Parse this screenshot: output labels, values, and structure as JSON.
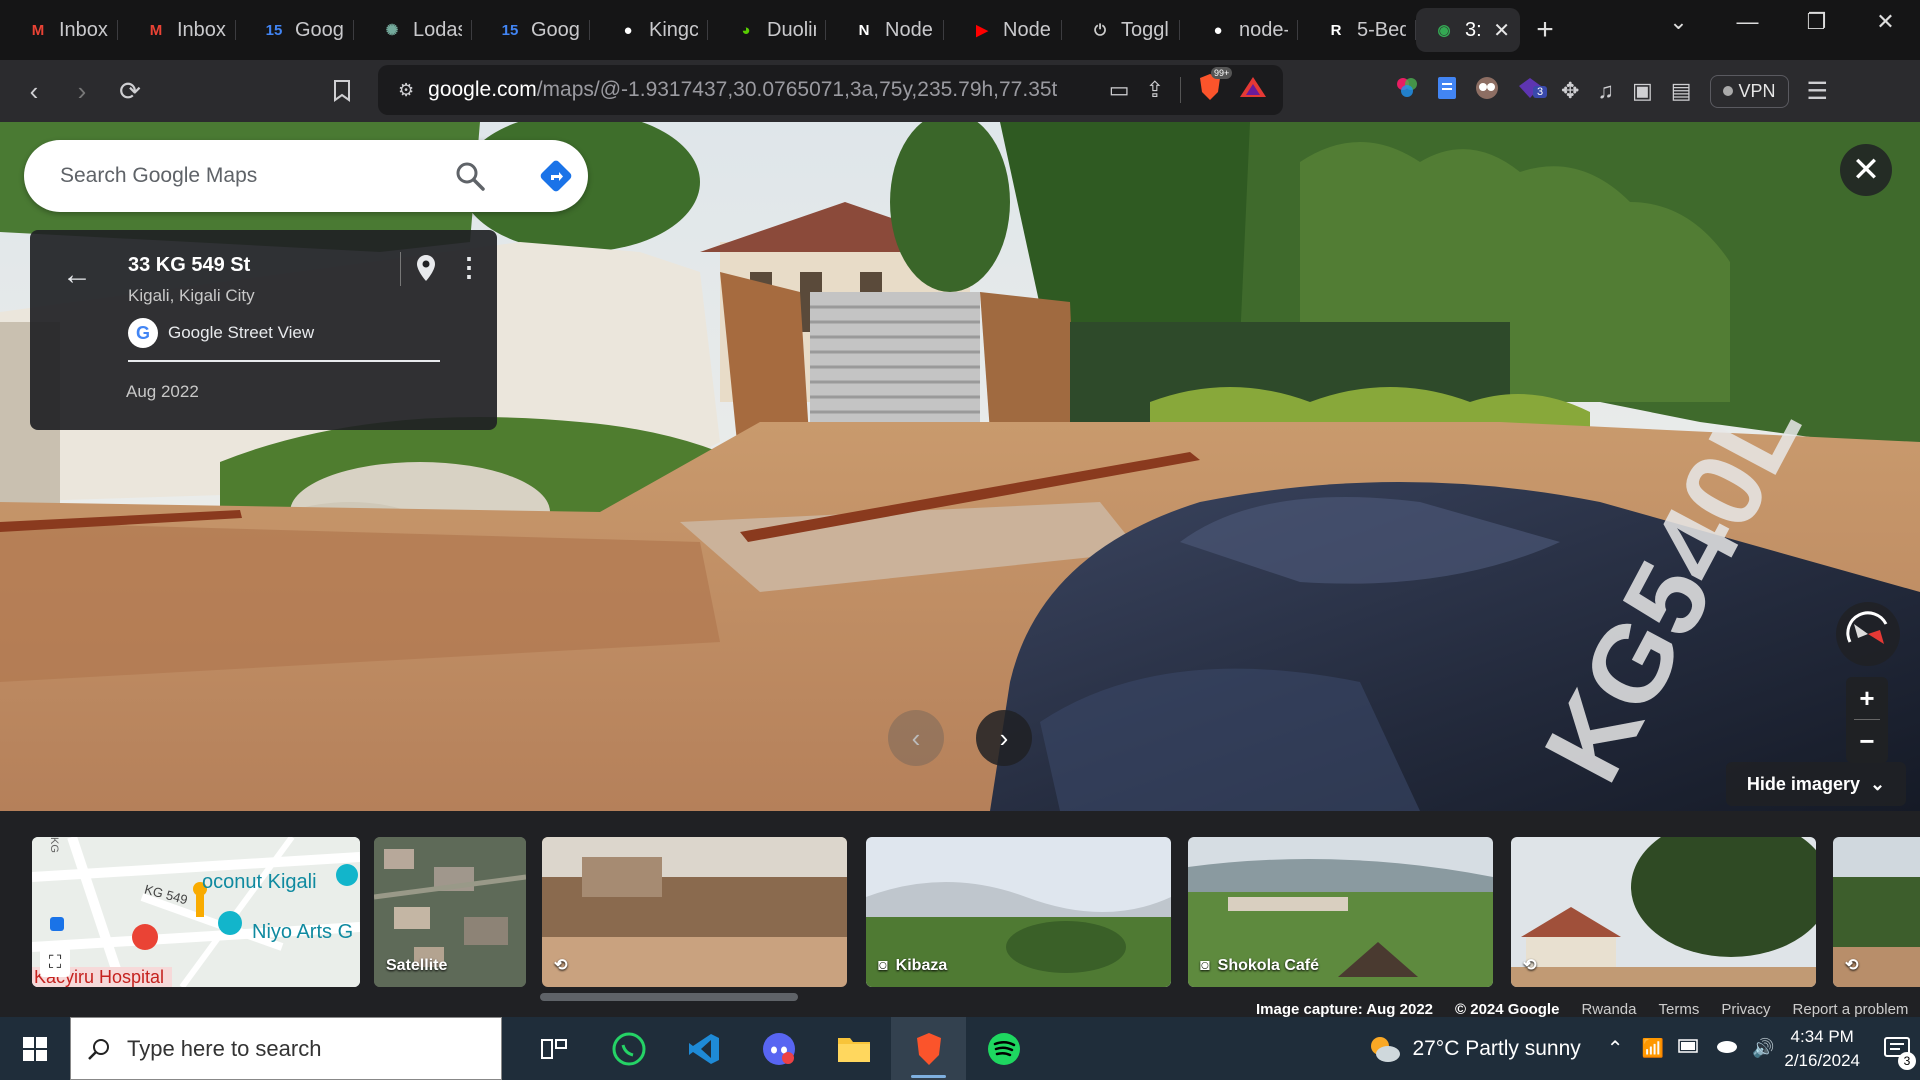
{
  "tabs": [
    {
      "title": "Inbox",
      "icon": "gmail-icon",
      "color": "#ea4335"
    },
    {
      "title": "Inbox",
      "icon": "gmail-icon",
      "color": "#ea4335"
    },
    {
      "title": "Googl",
      "icon": "google-calendar-icon",
      "color": "#4285f4"
    },
    {
      "title": "Lodas",
      "icon": "chatgpt-icon",
      "color": "#74aa9c"
    },
    {
      "title": "Googl",
      "icon": "google-calendar-icon",
      "color": "#4285f4"
    },
    {
      "title": "Kingc",
      "icon": "github-icon",
      "color": "#ffffff"
    },
    {
      "title": "Duolir",
      "icon": "duolingo-icon",
      "color": "#58cc02"
    },
    {
      "title": "Node",
      "icon": "notion-icon",
      "color": "#ffffff"
    },
    {
      "title": "Node",
      "icon": "youtube-icon",
      "color": "#ff0000"
    },
    {
      "title": "Toggl",
      "icon": "toggl-icon",
      "color": "#cccccc"
    },
    {
      "title": "node-",
      "icon": "github-icon",
      "color": "#ffffff"
    },
    {
      "title": "5-Bed",
      "icon": "realestate-icon",
      "color": "#ffffff"
    },
    {
      "title": "3:",
      "icon": "google-maps-icon",
      "color": "#34a853",
      "active": true
    }
  ],
  "toolbar": {
    "url_host": "google.com",
    "url_path": "/maps/@-1.9317437,30.0765071,3a,75y,235.79h,77.35t,...",
    "brave_badge": "99+",
    "ext_badge": "3",
    "vpn_label": "VPN"
  },
  "maps": {
    "search_placeholder": "Search Google Maps",
    "address": "33 KG 549 St",
    "city": "Kigali, Kigali City",
    "source": "Google Street View",
    "capture_date": "Aug 2022",
    "hide_imagery": "Hide imagery"
  },
  "filmstrip": {
    "map_labels": {
      "street": "KG 549",
      "place1": "oconut Kigali",
      "place2": "Niyo Arts G",
      "hospital": "Kacyiru Hospital",
      "kg": "KG"
    },
    "tiles": [
      {
        "caption": "Satellite"
      },
      {
        "caption": ""
      },
      {
        "caption": "Kibaza"
      },
      {
        "caption": "Shokola Café"
      },
      {
        "caption": ""
      },
      {
        "caption": ""
      }
    ],
    "footer": {
      "capture": "Image capture: Aug 2022",
      "copyright": "© 2024 Google",
      "country": "Rwanda",
      "terms": "Terms",
      "privacy": "Privacy",
      "report": "Report a problem"
    }
  },
  "taskbar": {
    "search_placeholder": "Type here to search",
    "weather": "27°C  Partly sunny",
    "time": "4:34 PM",
    "date": "2/16/2024",
    "notification_count": "3"
  },
  "colors": {
    "accent_blue": "#1a73e8",
    "maps_card": "#202124",
    "taskbar": "#1f2d3a"
  }
}
